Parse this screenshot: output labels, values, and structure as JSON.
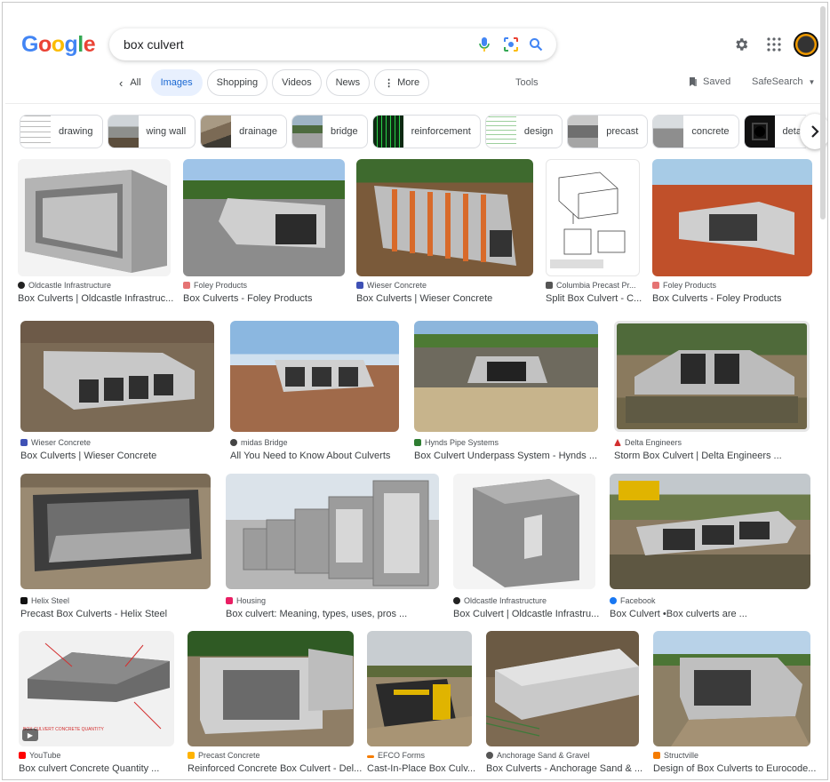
{
  "header": {
    "logo_text": "Google",
    "query": "box culvert"
  },
  "nav": {
    "back_label": "All",
    "items": [
      "Images",
      "Shopping",
      "Videos",
      "News"
    ],
    "more_label": "More",
    "tools_label": "Tools",
    "saved_label": "Saved",
    "safesearch_label": "SafeSearch"
  },
  "chips": [
    "drawing",
    "wing wall",
    "drainage",
    "bridge",
    "reinforcement",
    "design",
    "precast",
    "concrete",
    "deta"
  ],
  "results": [
    {
      "source": "Oldcastle Infrastructure",
      "title": "Box Culverts | Oldcastle Infrastruc..."
    },
    {
      "source": "Foley Products",
      "title": "Box Culverts - Foley Products"
    },
    {
      "source": "Wieser Concrete",
      "title": "Box Culverts | Wieser Concrete"
    },
    {
      "source": "Columbia Precast Pr...",
      "title": "Split Box Culvert - C..."
    },
    {
      "source": "Foley Products",
      "title": "Box Culverts - Foley Products"
    },
    {
      "source": "Wieser Concrete",
      "title": "Box Culverts | Wieser Concrete"
    },
    {
      "source": "midas Bridge",
      "title": "All You Need to Know About Culverts"
    },
    {
      "source": "Hynds Pipe Systems",
      "title": "Box Culvert Underpass System - Hynds ..."
    },
    {
      "source": "Delta Engineers",
      "title": "Storm Box Culvert | Delta Engineers ..."
    },
    {
      "source": "Helix Steel",
      "title": "Precast Box Culverts - Helix Steel"
    },
    {
      "source": "Housing",
      "title": "Box culvert: Meaning, types, uses, pros ..."
    },
    {
      "source": "Oldcastle Infrastructure",
      "title": "Box Culvert | Oldcastle Infrastru..."
    },
    {
      "source": "Facebook",
      "title": "Box Culvert •Box culverts are ..."
    },
    {
      "source": "YouTube",
      "title": "Box culvert Concrete Quantity ..."
    },
    {
      "source": "Precast Concrete",
      "title": "Reinforced Concrete Box Culvert - Del..."
    },
    {
      "source": "EFCO Forms",
      "title": "Cast-In-Place Box Culv..."
    },
    {
      "source": "Anchorage Sand & Gravel",
      "title": "Box Culverts - Anchorage Sand & ..."
    },
    {
      "source": "Structville",
      "title": "Design of Box Culverts to Eurocode..."
    }
  ],
  "colors": {
    "active_tab_bg": "#e8f0fe",
    "active_tab_text": "#1967d2",
    "link_blue": "#1a0dab"
  }
}
